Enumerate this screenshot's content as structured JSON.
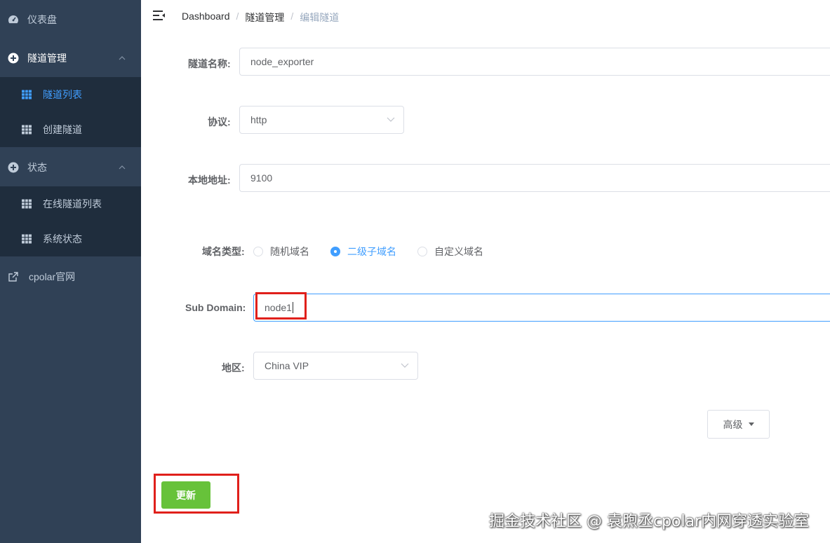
{
  "sidebar": {
    "dashboard": {
      "label": "仪表盘",
      "icon": "dashboard-icon"
    },
    "tunnel_mgmt": {
      "label": "隧道管理",
      "icon": "plus-circle-icon"
    },
    "tunnel_list": {
      "label": "隧道列表",
      "icon": "table-icon"
    },
    "create_tunnel": {
      "label": "创建隧道",
      "icon": "table-icon"
    },
    "status": {
      "label": "状态",
      "icon": "plus-circle-icon"
    },
    "online_tunnels": {
      "label": "在线隧道列表",
      "icon": "table-icon"
    },
    "system_status": {
      "label": "系统状态",
      "icon": "table-icon"
    },
    "cpolar_site": {
      "label": "cpolar官网",
      "icon": "external-link-icon"
    }
  },
  "breadcrumb": {
    "home": "Dashboard",
    "parent": "隧道管理",
    "current": "编辑隧道",
    "separator": "/"
  },
  "form": {
    "tunnel_name": {
      "label": "隧道名称:",
      "value": "node_exporter"
    },
    "protocol": {
      "label": "协议:",
      "value": "http"
    },
    "local_address": {
      "label": "本地地址:",
      "value": "9100"
    },
    "domain_type": {
      "label": "域名类型:",
      "options": [
        "随机域名",
        "二级子域名",
        "自定义域名"
      ],
      "selected": "二级子域名"
    },
    "sub_domain": {
      "label": "Sub Domain:",
      "value": "node1"
    },
    "region": {
      "label": "地区:",
      "value": "China VIP"
    },
    "advanced_button": "高级",
    "update_button": "更新"
  },
  "watermark": "掘金技术社区 @ 袁煦丞cpolar内网穿透实验室",
  "colors": {
    "sidebar_bg": "#304156",
    "submenu_bg": "#1f2d3d",
    "active": "#409eff",
    "success": "#67c23a",
    "highlight_box": "#e0201b"
  }
}
